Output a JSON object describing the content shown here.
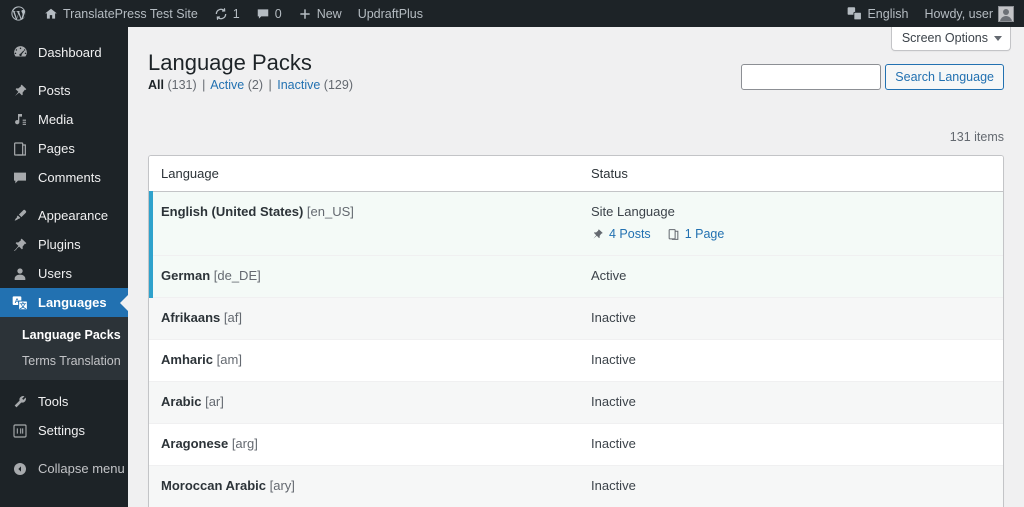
{
  "adminbar": {
    "logo_icon": "wordpress-icon",
    "site_icon": "home-icon",
    "site_name": "TranslatePress Test Site",
    "updates_icon": "updates-icon",
    "updates_count": "1",
    "comments_icon": "comment-icon",
    "comments_count": "0",
    "new_icon": "plus-icon",
    "new_label": "New",
    "updraft_label": "UpdraftPlus",
    "language_icon": "translate-icon",
    "language_label": "English",
    "howdy_label": "Howdy, user",
    "avatar_name": "avatar"
  },
  "sidebar": {
    "items": [
      {
        "label": "Dashboard",
        "icon": "dashboard-icon",
        "name": "sidebar-item-dashboard"
      },
      {
        "label": "Posts",
        "icon": "pin-icon",
        "name": "sidebar-item-posts"
      },
      {
        "label": "Media",
        "icon": "media-icon",
        "name": "sidebar-item-media"
      },
      {
        "label": "Pages",
        "icon": "pages-icon",
        "name": "sidebar-item-pages"
      },
      {
        "label": "Comments",
        "icon": "comment-icon",
        "name": "sidebar-item-comments"
      },
      {
        "label": "Appearance",
        "icon": "brush-icon",
        "name": "sidebar-item-appearance"
      },
      {
        "label": "Plugins",
        "icon": "plugin-icon",
        "name": "sidebar-item-plugins"
      },
      {
        "label": "Users",
        "icon": "user-icon",
        "name": "sidebar-item-users"
      },
      {
        "label": "Languages",
        "icon": "translate-icon",
        "name": "sidebar-item-languages"
      },
      {
        "label": "Tools",
        "icon": "wrench-icon",
        "name": "sidebar-item-tools"
      },
      {
        "label": "Settings",
        "icon": "settings-icon",
        "name": "sidebar-item-settings"
      }
    ],
    "submenu": [
      {
        "label": "Language Packs",
        "current": true
      },
      {
        "label": "Terms Translation",
        "current": false
      }
    ],
    "collapse_label": "Collapse menu",
    "collapse_icon": "collapse-arrow-icon",
    "current_color": "#2271b1"
  },
  "screen_meta": {
    "screen_options_label": "Screen Options",
    "caret_icon": "chevron-down-icon"
  },
  "main": {
    "page_title": "Language Packs",
    "filters": [
      {
        "label": "All",
        "count": "(131)",
        "current": true
      },
      {
        "label": "Active",
        "count": "(2)",
        "current": false
      },
      {
        "label": "Inactive",
        "count": "(129)",
        "current": false
      }
    ],
    "filter_separator": "|",
    "search": {
      "value": "",
      "placeholder": "",
      "button_label": "Search Language",
      "name": "search-input"
    },
    "displaying_num": "131 items"
  },
  "table": {
    "columns": [
      {
        "label": "Language",
        "name": "column-header-language"
      },
      {
        "label": "Status",
        "name": "column-header-status"
      }
    ],
    "accent_color": "#2ea2cc",
    "rows": [
      {
        "name": "English (United States)",
        "code": "[en_US]",
        "status": "Site Language",
        "accent": true,
        "shade": "active",
        "meta": [
          {
            "icon": "pin-icon",
            "label": "4 Posts",
            "link": true
          },
          {
            "icon": "pages-icon",
            "label": "1 Page",
            "link": true
          }
        ]
      },
      {
        "name": "German",
        "code": "[de_DE]",
        "status": "Active",
        "accent": true,
        "shade": "active",
        "meta": []
      },
      {
        "name": "Afrikaans",
        "code": "[af]",
        "status": "Inactive",
        "accent": false,
        "shade": "alt",
        "meta": []
      },
      {
        "name": "Amharic",
        "code": "[am]",
        "status": "Inactive",
        "accent": false,
        "shade": "plain",
        "meta": []
      },
      {
        "name": "Arabic",
        "code": "[ar]",
        "status": "Inactive",
        "accent": false,
        "shade": "alt",
        "meta": []
      },
      {
        "name": "Aragonese",
        "code": "[arg]",
        "status": "Inactive",
        "accent": false,
        "shade": "plain",
        "meta": []
      },
      {
        "name": "Moroccan Arabic",
        "code": "[ary]",
        "status": "Inactive",
        "accent": false,
        "shade": "alt",
        "meta": []
      }
    ]
  }
}
